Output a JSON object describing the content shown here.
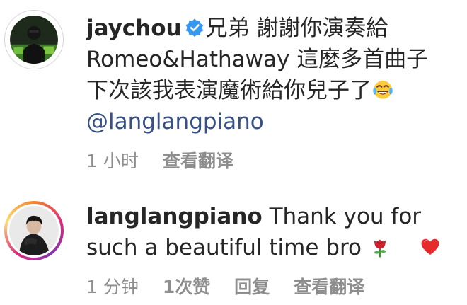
{
  "comments": [
    {
      "username": "jaychou",
      "verified": true,
      "lines": [
        "兄弟 謝謝你演奏給",
        "Romeo&Hathaway 這麼多首曲子",
        "下次該我表演魔術給你兒子了"
      ],
      "emoji_end": "face-with-tears-of-joy",
      "mention": "@langlangpiano",
      "time": "1 小时",
      "translate": "查看翻译"
    },
    {
      "username": "langlangpiano",
      "verified": false,
      "lines": [
        "Thank you for",
        "such a beautiful time bro"
      ],
      "emojis": [
        "rose",
        "red-heart"
      ],
      "time": "1 分钟",
      "likes": "1次赞",
      "reply": "回复",
      "translate": "查看翻译"
    }
  ]
}
